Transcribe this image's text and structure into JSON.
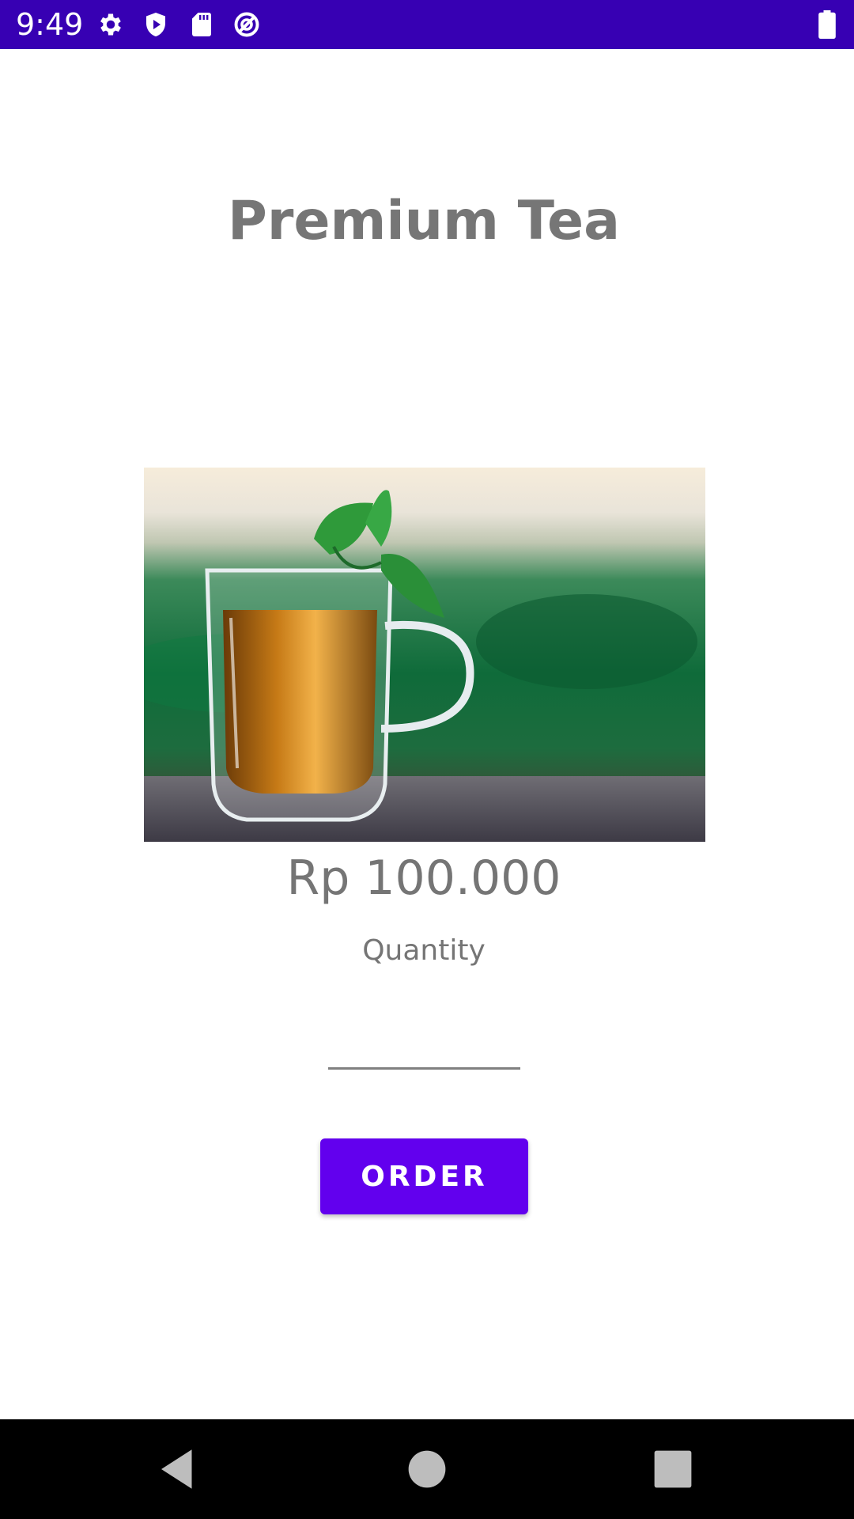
{
  "status_bar": {
    "time": "9:49",
    "background": "#3700b3",
    "icons": [
      "settings-icon",
      "shield-play-icon",
      "sd-card-icon",
      "no-disturb-icon",
      "battery-icon"
    ]
  },
  "product": {
    "title": "Premium Tea",
    "price": "Rp 100.000",
    "image": "glass-mug-of-tea-with-mint"
  },
  "quantity": {
    "label": "Quantity",
    "value": ""
  },
  "order_button": {
    "label": "ORDER",
    "color": "#6200ee"
  },
  "nav_bar": {
    "buttons": [
      "back-icon",
      "home-icon",
      "recents-icon"
    ]
  }
}
